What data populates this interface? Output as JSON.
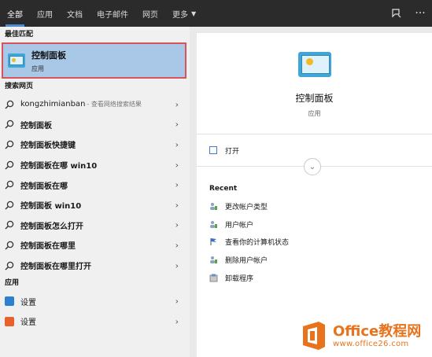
{
  "topbar": {
    "tabs": [
      {
        "label": "全部",
        "active": true
      },
      {
        "label": "应用"
      },
      {
        "label": "文档"
      },
      {
        "label": "电子邮件"
      },
      {
        "label": "网页"
      },
      {
        "label": "更多"
      }
    ],
    "icons": [
      "feedback-icon",
      "more-options-icon"
    ]
  },
  "left": {
    "best_match_header": "最佳匹配",
    "best_match": {
      "title": "控制面板",
      "subtitle": "应用"
    },
    "web_header": "搜索网页",
    "web_items": [
      {
        "label": "kongzhimianban",
        "hint": "- 查看网络搜索结果"
      },
      {
        "label": "控制面板"
      },
      {
        "label": "控制面板快捷键"
      },
      {
        "label": "控制面板在哪 win10"
      },
      {
        "label": "控制面板在哪"
      },
      {
        "label": "控制面板 win10"
      },
      {
        "label": "控制面板怎么打开"
      },
      {
        "label": "控制面板在哪里"
      },
      {
        "label": "控制面板在哪里打开"
      }
    ],
    "apps_header": "应用",
    "app_items": [
      {
        "label": "设置",
        "icon": "settings-app-icon",
        "color": "#2f7fd1"
      },
      {
        "label": "设置",
        "icon": "settings-app-icon-orange",
        "color": "#e8602c"
      }
    ]
  },
  "right": {
    "title": "控制面板",
    "subtitle": "应用",
    "open_label": "打开",
    "recent_header": "Recent",
    "recent_items": [
      {
        "label": "更改帐户类型"
      },
      {
        "label": "用户帐户"
      },
      {
        "label": "查看你的计算机状态"
      },
      {
        "label": "删除用户帐户"
      },
      {
        "label": "卸载程序"
      }
    ]
  },
  "watermark": {
    "brand_a": "Office",
    "brand_b": "教程网",
    "url": "www.office26.com"
  },
  "colors": {
    "accent": "#4c8bd6",
    "highlight": "#a9c8e7",
    "selection_border": "#d9535a",
    "topbar": "#2b2b2b"
  }
}
